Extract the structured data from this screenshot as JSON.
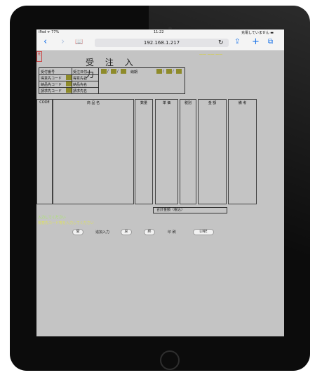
{
  "status": {
    "left": "iPad ᯤ 77%",
    "time": "11:22",
    "right": "充電していません ▬"
  },
  "toolbar": {
    "back": "‹",
    "forward": "›",
    "bookmarks": "📖",
    "url": "192.168.1.217",
    "reload": "↻",
    "share": "⇪",
    "new_tab": "+",
    "tabs": "⧉"
  },
  "page": {
    "title": "受 注 入 力",
    "logo": "社",
    "top_right_text": "—— —— ——",
    "header": {
      "labels": [
        "受付番号",
        "得意先コード",
        "納品先コード",
        "請求先コード"
      ],
      "mid_labels": [
        "受注日付",
        "得意先名",
        "納品先名",
        "請求先名"
      ],
      "delivery_label": "納期",
      "date_sep": "/"
    },
    "columns": [
      "CODE",
      "商 品 名",
      "数量",
      "単 価",
      "税別",
      "金 額",
      "備 考"
    ],
    "total_label": "合計金額（税込）",
    "messages": [
      "入力してください",
      "得意先コード等を入力してください"
    ],
    "buttons": [
      "受",
      "追加入力",
      "戻",
      "終",
      "印 刷",
      "LINE"
    ]
  },
  "colors": {
    "accent": "#1a73e8",
    "input_olive": "#8e8b2a",
    "page_bg": "#c4c4c4",
    "yellow_text": "#ddd400",
    "green_text": "#a8ea60"
  }
}
